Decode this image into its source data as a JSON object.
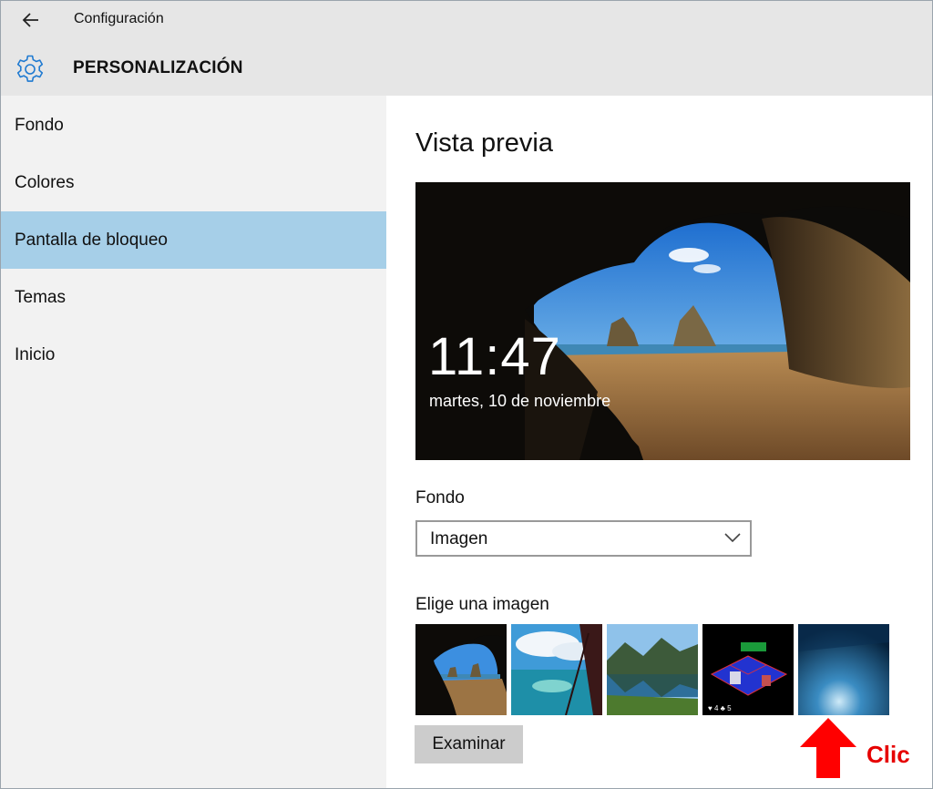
{
  "window": {
    "app_title": "Configuración",
    "section_title": "PERSONALIZACIÓN"
  },
  "icons": {
    "back": "back-arrow-icon",
    "settings": "gear-icon",
    "dropdown": "chevron-down-icon",
    "annotation": "red-up-arrow-icon"
  },
  "sidebar": {
    "items": [
      {
        "label": "Fondo",
        "selected": false
      },
      {
        "label": "Colores",
        "selected": false
      },
      {
        "label": "Pantalla de bloqueo",
        "selected": true
      },
      {
        "label": "Temas",
        "selected": false
      },
      {
        "label": "Inicio",
        "selected": false
      }
    ]
  },
  "main": {
    "preview_heading": "Vista previa",
    "preview": {
      "time": "11:47",
      "date": "martes, 10 de noviembre"
    },
    "background_label": "Fondo",
    "background_value": "Imagen",
    "choose_label": "Elige una imagen",
    "thumbnails": [
      "cave-beach",
      "sky-ocean",
      "mountain-lake",
      "isometric-game",
      "ice-cave"
    ],
    "browse_label": "Examinar"
  },
  "annotation": {
    "text": "Clic",
    "color": "#e60000"
  },
  "colors": {
    "selected_nav": "#a6cfe8",
    "accent": "#0078d7",
    "titlebar": "#e6e6e6",
    "sidebar": "#f2f2f2"
  }
}
